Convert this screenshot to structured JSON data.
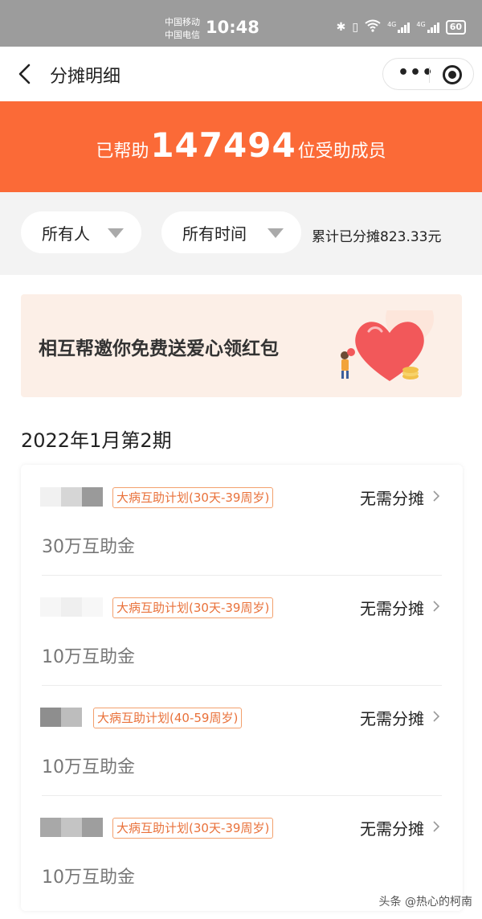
{
  "status_bar": {
    "carrier_1": "中国移动",
    "carrier_2": "中国电信",
    "time": "10:48",
    "battery": "60",
    "network": "4G"
  },
  "nav": {
    "title": "分摊明细",
    "more_icon": "more-dots-icon",
    "close_icon": "target-circle-icon"
  },
  "banner": {
    "prefix": "已帮助",
    "count": "147494",
    "suffix": "位受助成员",
    "color": "#fb6a37"
  },
  "filters": {
    "person_filter": "所有人",
    "time_filter": "所有时间",
    "total_shared": "累计已分摊823.33元"
  },
  "promo": {
    "text": "相互帮邀你免费送爱心领红包"
  },
  "period": "2022年1月第2期",
  "records": [
    {
      "plan": "大病互助计划(30天-39周岁)",
      "status": "无需分摊",
      "amount": "30万互助金"
    },
    {
      "plan": "大病互助计划(30天-39周岁)",
      "status": "无需分摊",
      "amount": "10万互助金"
    },
    {
      "plan": "大病互助计划(40-59周岁)",
      "status": "无需分摊",
      "amount": "10万互助金"
    },
    {
      "plan": "大病互助计划(30天-39周岁)",
      "status": "无需分摊",
      "amount": "10万互助金"
    }
  ],
  "watermark": "头条 @热心的柯南"
}
